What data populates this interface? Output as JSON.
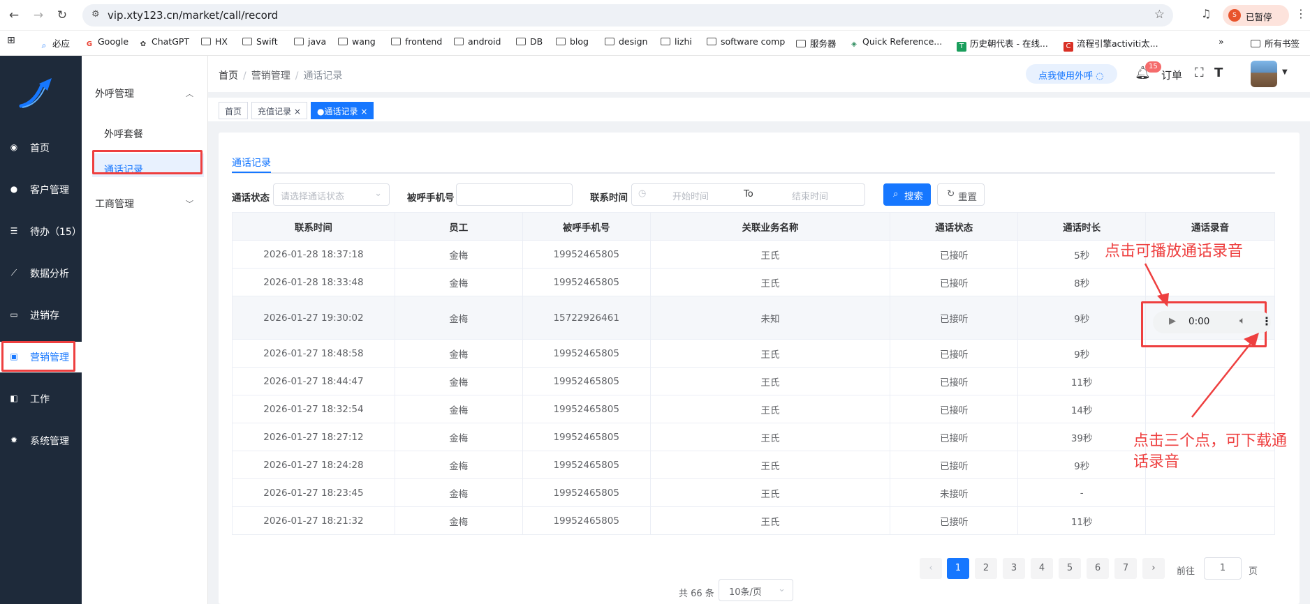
{
  "browser": {
    "url": "vip.xty123.cn/market/call/record",
    "profile_initial": "S",
    "profile_label": "已暂停",
    "bookmarks": [
      "必应",
      "Google",
      "ChatGPT",
      "HX",
      "Swift",
      "java",
      "wang",
      "frontend",
      "android",
      "DB",
      "blog",
      "design",
      "lizhi",
      "software comp",
      "服务器",
      "Quick Reference...",
      "历史朝代表 - 在线...",
      "流程引擎activiti太...",
      "所有书签"
    ],
    "more_label": "»"
  },
  "sidebar": {
    "items": [
      {
        "label": "首页",
        "icon": "dashboard-icon"
      },
      {
        "label": "客户管理",
        "icon": "user-icon"
      },
      {
        "label": "待办（15）",
        "icon": "sliders-icon"
      },
      {
        "label": "数据分析",
        "icon": "chart-icon"
      },
      {
        "label": "进销存",
        "icon": "box-icon"
      },
      {
        "label": "营销管理",
        "icon": "marketing-icon"
      },
      {
        "label": "工作",
        "icon": "book-icon"
      },
      {
        "label": "系统管理",
        "icon": "gear-icon"
      }
    ],
    "active_index": 5
  },
  "submenu": {
    "group1": "外呼管理",
    "sub1": "外呼套餐",
    "sub2": "通话记录",
    "group2": "工商管理"
  },
  "header": {
    "breadcrumb": [
      "首页",
      "营销管理",
      "通话记录"
    ],
    "call_button": "点我使用外呼",
    "bell_badge": "15",
    "order_label": "订单"
  },
  "tabs": [
    {
      "label": "首页",
      "active": false,
      "closable": false
    },
    {
      "label": "充值记录",
      "active": false,
      "closable": true
    },
    {
      "label": "●通话记录",
      "active": true,
      "closable": true
    }
  ],
  "card": {
    "tab_label": "通话记录",
    "filters": {
      "status_label": "通话状态",
      "status_placeholder": "请选择通话状态",
      "phone_label": "被呼手机号",
      "phone_value": "",
      "time_label": "联系时间",
      "start_placeholder": "开始时间",
      "range_sep": "To",
      "end_placeholder": "结束时间",
      "search_button": "搜索",
      "reset_button": "重置"
    },
    "columns": [
      "联系时间",
      "员工",
      "被呼手机号",
      "关联业务名称",
      "通话状态",
      "通话时长",
      "通话录音"
    ],
    "rows": [
      {
        "time": "2026-01-28 18:37:18",
        "staff": "金梅",
        "phone": "19952465805",
        "biz": "王氏",
        "status": "已接听",
        "duration": "5秒"
      },
      {
        "time": "2026-01-28 18:33:48",
        "staff": "金梅",
        "phone": "19952465805",
        "biz": "王氏",
        "status": "已接听",
        "duration": "8秒"
      },
      {
        "time": "2026-01-27 19:30:02",
        "staff": "金梅",
        "phone": "15722926461",
        "biz": "未知",
        "status": "已接听",
        "duration": "9秒"
      },
      {
        "time": "2026-01-27 18:48:58",
        "staff": "金梅",
        "phone": "19952465805",
        "biz": "王氏",
        "status": "已接听",
        "duration": "9秒"
      },
      {
        "time": "2026-01-27 18:44:47",
        "staff": "金梅",
        "phone": "19952465805",
        "biz": "王氏",
        "status": "已接听",
        "duration": "11秒"
      },
      {
        "time": "2026-01-27 18:32:54",
        "staff": "金梅",
        "phone": "19952465805",
        "biz": "王氏",
        "status": "已接听",
        "duration": "14秒"
      },
      {
        "time": "2026-01-27 18:27:12",
        "staff": "金梅",
        "phone": "19952465805",
        "biz": "王氏",
        "status": "已接听",
        "duration": "39秒"
      },
      {
        "time": "2026-01-27 18:24:28",
        "staff": "金梅",
        "phone": "19952465805",
        "biz": "王氏",
        "status": "已接听",
        "duration": "9秒"
      },
      {
        "time": "2026-01-27 18:23:45",
        "staff": "金梅",
        "phone": "19952465805",
        "biz": "王氏",
        "status": "未接听",
        "duration": "-"
      },
      {
        "time": "2026-01-27 18:21:32",
        "staff": "金梅",
        "phone": "19952465805",
        "biz": "王氏",
        "status": "已接听",
        "duration": "11秒"
      }
    ],
    "audio_time": "0:00"
  },
  "annotations": {
    "play_note": "点击可播放通话录音",
    "download_note_line1": "点击三个点，可下载通",
    "download_note_line2": "话录音"
  },
  "pagination": {
    "total": "共 66 条",
    "page_size": "10条/页",
    "pages": [
      "1",
      "2",
      "3",
      "4",
      "5",
      "6",
      "7"
    ],
    "current": "1",
    "goto_label": "前往",
    "goto_value": "1",
    "page_suffix": "页"
  },
  "colors": {
    "accent": "#1677ff",
    "sidebar": "#1e2a3a",
    "success": "#52c41a",
    "danger": "#f56c6c",
    "annotation": "#ee3f3f"
  }
}
